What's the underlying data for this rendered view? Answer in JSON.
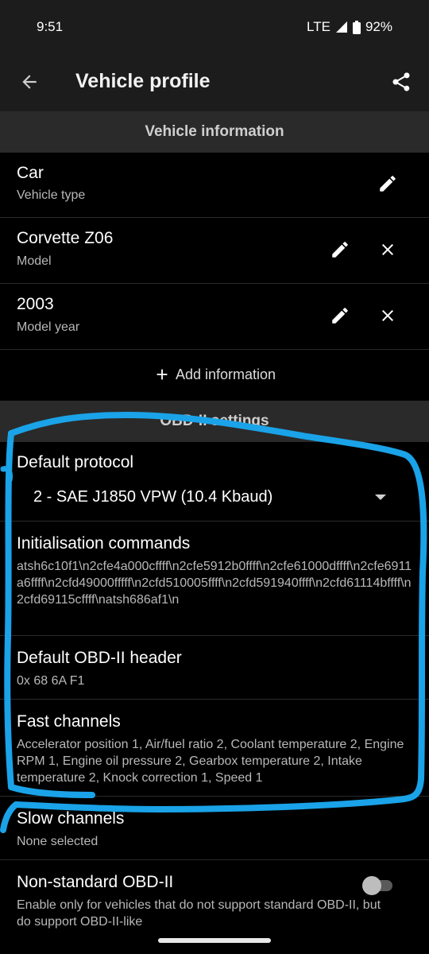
{
  "status": {
    "time": "9:51",
    "network": "LTE",
    "battery": "92%"
  },
  "app_bar": {
    "title": "Vehicle profile"
  },
  "vehicle_info": {
    "header": "Vehicle information",
    "rows": [
      {
        "title": "Car",
        "subtitle": "Vehicle type"
      },
      {
        "title": "Corvette Z06",
        "subtitle": "Model"
      },
      {
        "title": "2003",
        "subtitle": "Model year"
      }
    ],
    "add_label": "Add information"
  },
  "obd": {
    "header": "OBD-II settings",
    "protocol": {
      "title": "Default protocol",
      "value": "2 - SAE J1850 VPW (10.4 Kbaud)"
    },
    "init": {
      "title": "Initialisation commands",
      "value": "atsh6c10f1\\n2cfe4a000cffff\\n2cfe5912b0ffff\\n2cfe61000dffff\\n2cfe6911a6ffff\\n2cfd49000fffff\\n2cfd510005ffff\\n2cfd591940ffff\\n2cfd61114bffff\\n2cfd69115cffff\\natsh686af1\\n"
    },
    "header_setting": {
      "title": "Default OBD-II header",
      "value": "0x 68 6A F1"
    },
    "fast": {
      "title": "Fast channels",
      "value": "Accelerator position 1, Air/fuel ratio 2, Coolant temperature 2, Engine RPM 1, Engine oil pressure 2, Gearbox temperature 2, Intake temperature 2, Knock correction 1, Speed 1"
    },
    "slow": {
      "title": "Slow channels",
      "value": "None selected"
    },
    "nonstandard": {
      "title": "Non-standard OBD-II",
      "value": "Enable only for vehicles that do not support standard OBD-II, but do support OBD-II-like"
    }
  },
  "colors": {
    "annotation": "#1aa3e8",
    "background": "#000000",
    "header": "#2a2a2a"
  }
}
